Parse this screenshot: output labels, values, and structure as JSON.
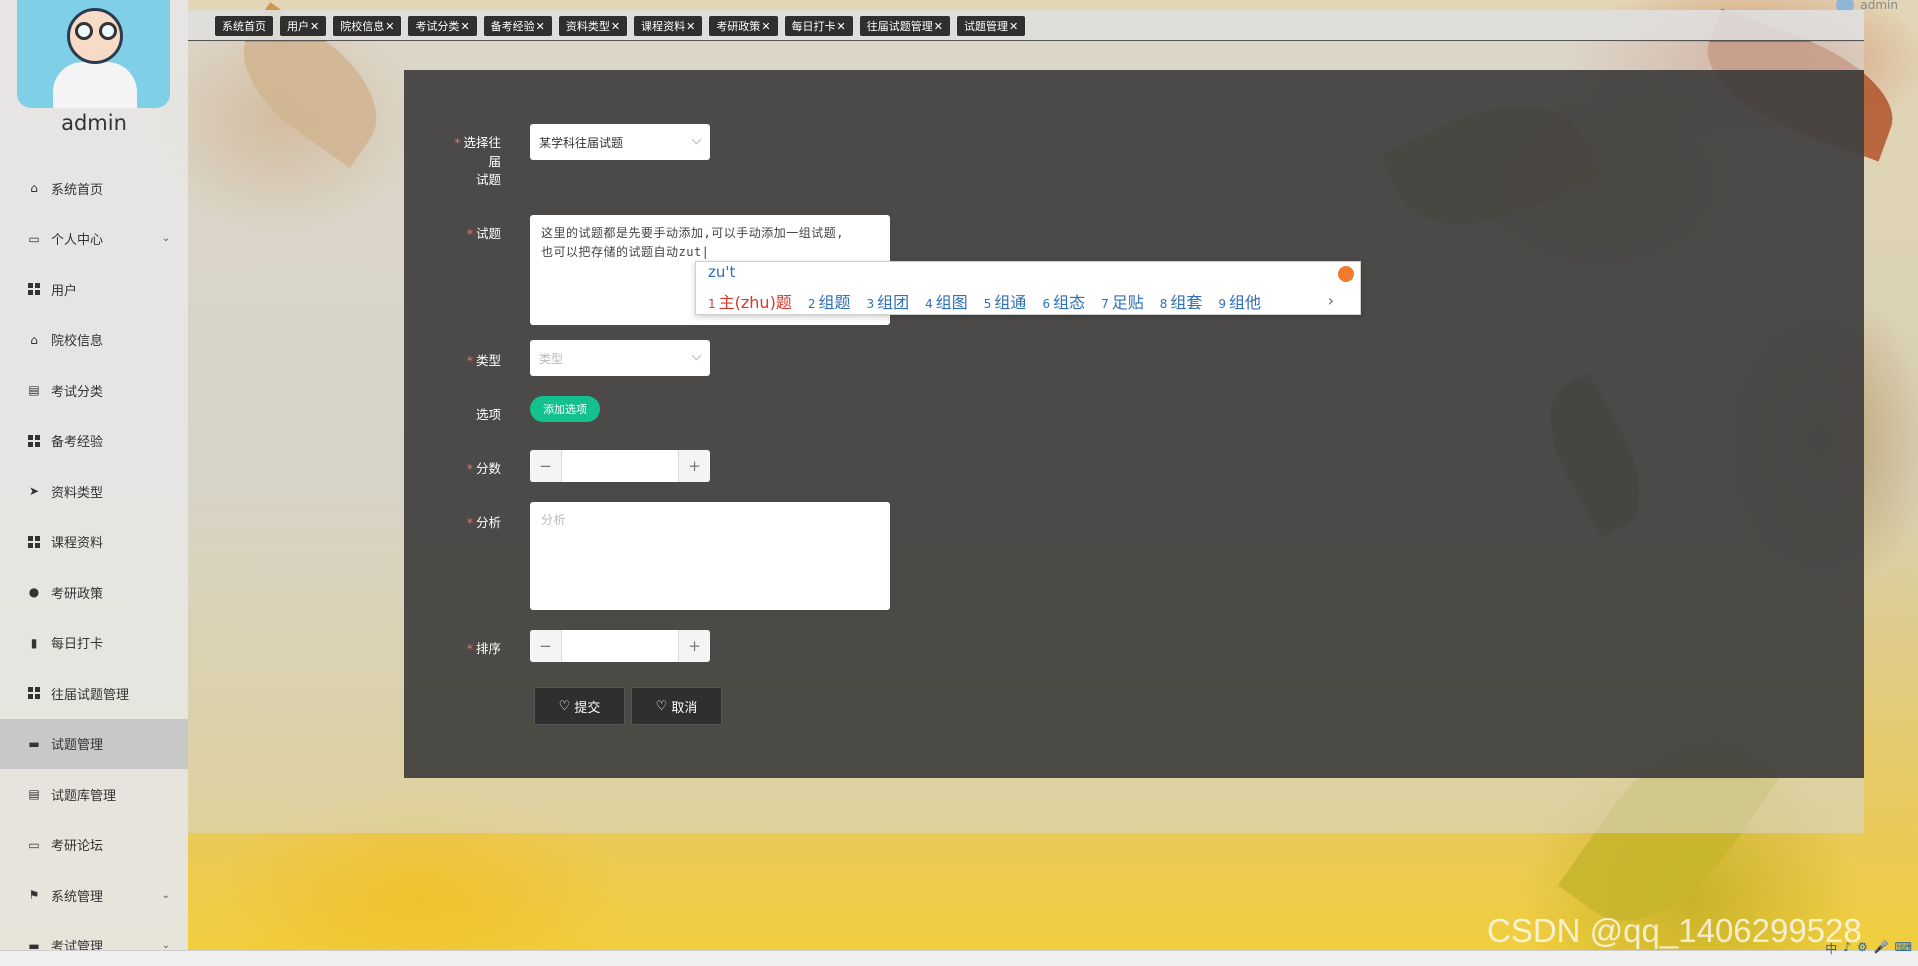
{
  "user": {
    "name": "admin"
  },
  "top_user": {
    "name": "admin"
  },
  "tabs": [
    {
      "label": "系统首页",
      "closable": false
    },
    {
      "label": "用户",
      "closable": true
    },
    {
      "label": "院校信息",
      "closable": true
    },
    {
      "label": "考试分类",
      "closable": true
    },
    {
      "label": "备考经验",
      "closable": true
    },
    {
      "label": "资料类型",
      "closable": true
    },
    {
      "label": "课程资料",
      "closable": true
    },
    {
      "label": "考研政策",
      "closable": true
    },
    {
      "label": "每日打卡",
      "closable": true
    },
    {
      "label": "往届试题管理",
      "closable": true
    },
    {
      "label": "试题管理",
      "closable": true
    }
  ],
  "tab_close_glyph": "✕",
  "sidebar": {
    "items": [
      {
        "label": "系统首页",
        "icon": "home-icon"
      },
      {
        "label": "个人中心",
        "icon": "calendar-icon",
        "expandable": true
      },
      {
        "label": "用户",
        "icon": "grid-icon"
      },
      {
        "label": "院校信息",
        "icon": "school-icon"
      },
      {
        "label": "考试分类",
        "icon": "clipboard-icon"
      },
      {
        "label": "备考经验",
        "icon": "grid-icon"
      },
      {
        "label": "资料类型",
        "icon": "send-icon"
      },
      {
        "label": "课程资料",
        "icon": "grid-icon"
      },
      {
        "label": "考研政策",
        "icon": "person-icon"
      },
      {
        "label": "每日打卡",
        "icon": "book-icon"
      },
      {
        "label": "往届试题管理",
        "icon": "grid-icon"
      },
      {
        "label": "试题管理",
        "icon": "tablet-icon",
        "active": true
      },
      {
        "label": "试题库管理",
        "icon": "clipboard-icon"
      },
      {
        "label": "考研论坛",
        "icon": "briefcase-icon"
      },
      {
        "label": "系统管理",
        "icon": "flag-icon",
        "expandable": true
      },
      {
        "label": "考试管理",
        "icon": "chat-icon",
        "expandable": true
      }
    ]
  },
  "form": {
    "past_exam": {
      "label_line1": "选择往届",
      "label_line2": "试题",
      "value": "某学科往届试题"
    },
    "question": {
      "label": "试题",
      "line1": "这里的试题都是先要手动添加,可以手动添加一组试题,",
      "line2": "也可以把存储的试题自动zut|"
    },
    "type": {
      "label": "类型",
      "placeholder": "类型"
    },
    "options": {
      "label": "选项",
      "add_button": "添加选项"
    },
    "score": {
      "label": "分数",
      "minus": "−",
      "plus": "+"
    },
    "analysis": {
      "label": "分析",
      "placeholder": "分析"
    },
    "order": {
      "label": "排序",
      "minus": "−",
      "plus": "+"
    },
    "submit": "提交",
    "cancel": "取消"
  },
  "ime": {
    "pinyin": "zu't",
    "candidates": [
      {
        "num": "1",
        "text": "主(zhu)题"
      },
      {
        "num": "2",
        "text": "组题"
      },
      {
        "num": "3",
        "text": "组团"
      },
      {
        "num": "4",
        "text": "组图"
      },
      {
        "num": "5",
        "text": "组通"
      },
      {
        "num": "6",
        "text": "组态"
      },
      {
        "num": "7",
        "text": "足贴"
      },
      {
        "num": "8",
        "text": "组套"
      },
      {
        "num": "9",
        "text": "组他"
      }
    ],
    "more": "›"
  },
  "watermark": "CSDN @qq_1406299528",
  "tray": [
    "中",
    "♪",
    "⚙",
    "🎤",
    "⌨"
  ],
  "colors": {
    "accent_green": "#13c18f",
    "required_star": "#f56c6c",
    "panel": "#373737",
    "ime_blue": "#2f6fb8",
    "ime_red": "#d9392a"
  }
}
